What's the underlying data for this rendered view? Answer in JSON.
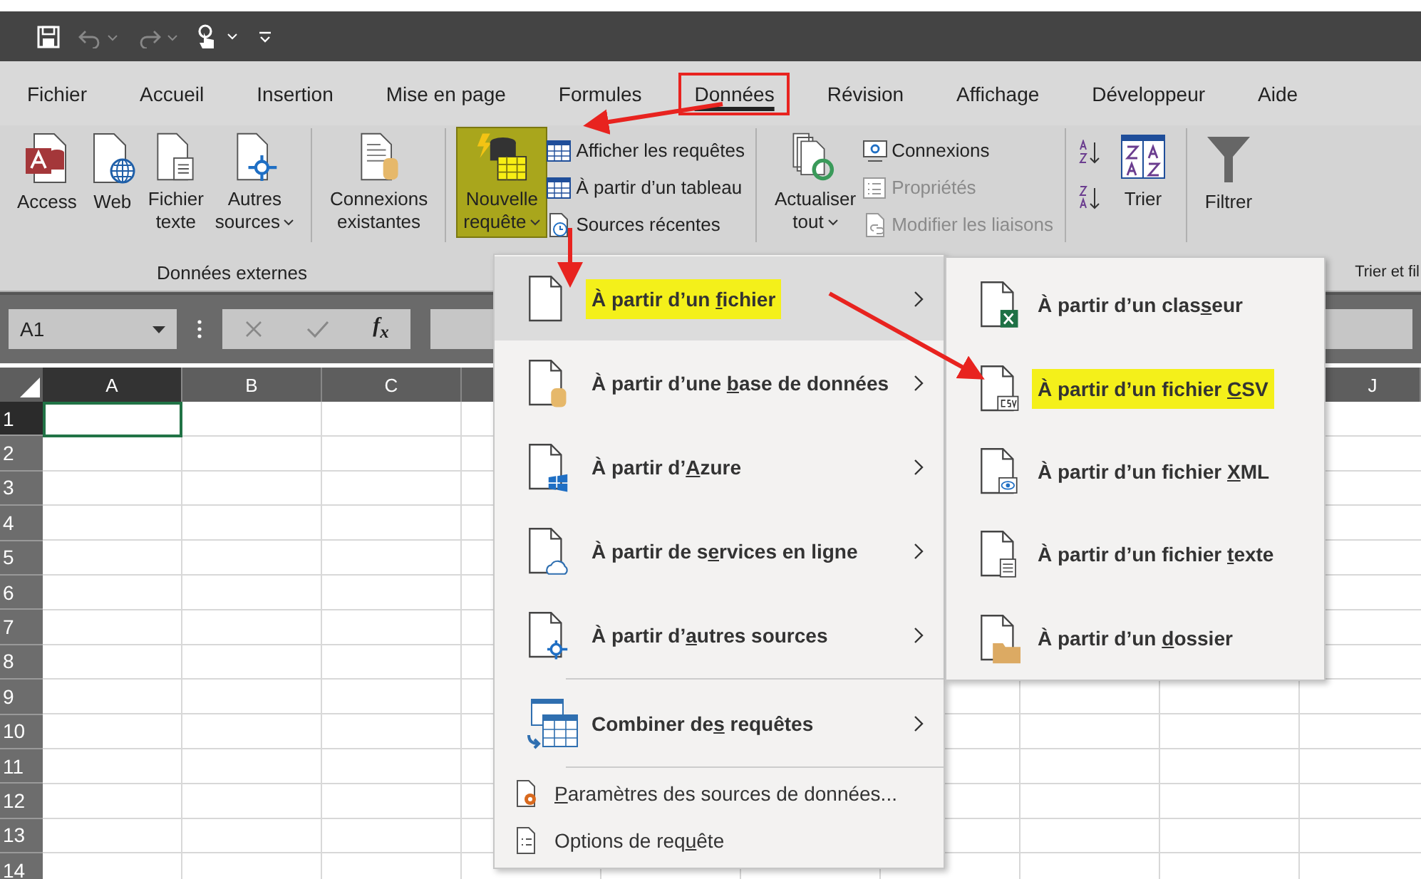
{
  "tabs": [
    {
      "label": "Fichier",
      "selected": false,
      "annotated": false
    },
    {
      "label": "Accueil",
      "selected": false,
      "annotated": false
    },
    {
      "label": "Insertion",
      "selected": false,
      "annotated": false
    },
    {
      "label": "Mise en page",
      "selected": false,
      "annotated": false
    },
    {
      "label": "Formules",
      "selected": false,
      "annotated": false
    },
    {
      "label": "Données",
      "selected": true,
      "annotated": true
    },
    {
      "label": "Révision",
      "selected": false,
      "annotated": false
    },
    {
      "label": "Affichage",
      "selected": false,
      "annotated": false
    },
    {
      "label": "Développeur",
      "selected": false,
      "annotated": false
    },
    {
      "label": "Aide",
      "selected": false,
      "annotated": false
    }
  ],
  "ribbon": [
    {
      "kind": "large",
      "lines": [
        "Access"
      ],
      "dropdown": false,
      "highlighted": false
    },
    {
      "kind": "large",
      "lines": [
        "Web"
      ],
      "dropdown": false,
      "highlighted": false
    },
    {
      "kind": "large",
      "lines": [
        "Fichier",
        "texte"
      ],
      "dropdown": false,
      "highlighted": false
    },
    {
      "kind": "large",
      "lines": [
        "Autres",
        "sources"
      ],
      "dropdown": true,
      "highlighted": false
    },
    {
      "kind": "separator"
    },
    {
      "kind": "large",
      "lines": [
        "Connexions",
        "existantes"
      ],
      "dropdown": false,
      "highlighted": false
    },
    {
      "kind": "separator"
    },
    {
      "kind": "large",
      "lines": [
        "Nouvelle",
        "requête"
      ],
      "dropdown": true,
      "highlighted": true
    },
    {
      "kind": "stack",
      "items": [
        {
          "label": "Afficher les requêtes",
          "disabled": false
        },
        {
          "label": "À partir d’un tableau",
          "disabled": false
        },
        {
          "label": "Sources récentes",
          "disabled": false
        }
      ]
    },
    {
      "kind": "separator"
    },
    {
      "kind": "large",
      "lines": [
        "Actualiser",
        "tout"
      ],
      "dropdown": true,
      "highlighted": false
    },
    {
      "kind": "stack",
      "items": [
        {
          "label": "Connexions",
          "disabled": false
        },
        {
          "label": "Propriétés",
          "disabled": true
        },
        {
          "label": "Modifier les liaisons",
          "disabled": true
        }
      ]
    },
    {
      "kind": "separator"
    },
    {
      "kind": "sort"
    },
    {
      "kind": "large",
      "lines": [
        "Trier"
      ],
      "dropdown": false,
      "highlighted": false
    },
    {
      "kind": "separator"
    },
    {
      "kind": "large",
      "lines": [
        "Filtrer"
      ],
      "dropdown": false,
      "highlighted": false
    }
  ],
  "group_labels": [
    {
      "text": "Données externes"
    },
    {
      "text": "Trier et fil"
    }
  ],
  "formula_bar": {
    "name_box": "A1",
    "function_label": "f$_{x}$"
  },
  "columns": [
    {
      "label": "A",
      "selected": true
    },
    {
      "label": "B",
      "selected": false
    },
    {
      "label": "C",
      "selected": false
    },
    {
      "label": "J",
      "selected": false
    }
  ],
  "rows": [
    {
      "label": "1",
      "selected": true
    },
    {
      "label": "2",
      "selected": false
    },
    {
      "label": "3",
      "selected": false
    },
    {
      "label": "4",
      "selected": false
    },
    {
      "label": "5",
      "selected": false
    },
    {
      "label": "6",
      "selected": false
    },
    {
      "label": "7",
      "selected": false
    },
    {
      "label": "8",
      "selected": false
    },
    {
      "label": "9",
      "selected": false
    },
    {
      "label": "10",
      "selected": false
    },
    {
      "label": "11",
      "selected": false
    },
    {
      "label": "12",
      "selected": false
    },
    {
      "label": "13",
      "selected": false
    },
    {
      "label": "14",
      "selected": false
    }
  ],
  "menu": [
    {
      "kind": "large",
      "pre": "À partir d’un ",
      "key": "f",
      "post": "ichier",
      "selected": true,
      "highlighted": true
    },
    {
      "kind": "large",
      "pre": "À partir d’une ",
      "key": "b",
      "post": "ase de données",
      "selected": false,
      "highlighted": false
    },
    {
      "kind": "large",
      "pre": "À partir d’",
      "key": "A",
      "post": "zure",
      "selected": false,
      "highlighted": false
    },
    {
      "kind": "large",
      "pre": "À partir de s",
      "key": "e",
      "post": "rvices en ligne",
      "selected": false,
      "highlighted": false
    },
    {
      "kind": "large",
      "pre": "À partir d’",
      "key": "a",
      "post": "utres sources",
      "selected": false,
      "highlighted": false
    },
    {
      "kind": "separator"
    },
    {
      "kind": "large",
      "pre": "Combiner de",
      "key": "s",
      "post": " requêtes",
      "selected": false,
      "highlighted": false
    },
    {
      "kind": "separator"
    },
    {
      "kind": "small",
      "key": "P",
      "post": "aramètres des sources de données..."
    },
    {
      "kind": "small",
      "pre": "Options de req",
      "key": "u",
      "post": "ête"
    }
  ],
  "submenu": [
    {
      "pre": "À partir d’un clas",
      "key": "s",
      "post": "eur",
      "highlighted": false
    },
    {
      "pre": "À partir d’un fichier ",
      "key": "C",
      "post": "SV",
      "highlighted": true
    },
    {
      "pre": "À partir d’un fichier ",
      "key": "X",
      "post": "ML",
      "highlighted": false
    },
    {
      "pre": "À partir d’un fichier ",
      "key": "t",
      "post": "exte",
      "highlighted": false
    },
    {
      "pre": "À partir d’un ",
      "key": "d",
      "post": "ossier",
      "highlighted": false
    }
  ]
}
